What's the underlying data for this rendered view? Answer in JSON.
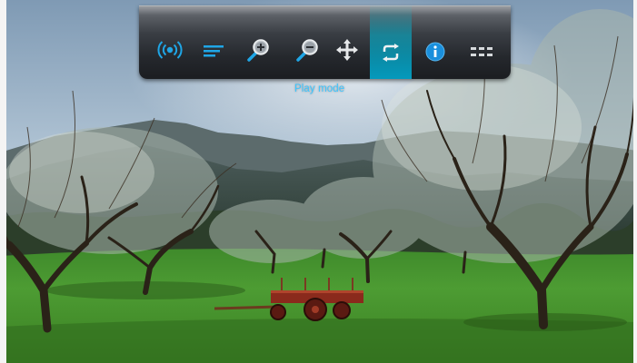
{
  "toolbar": {
    "selected": "play-mode",
    "tooltip": "Play mode",
    "buttons": [
      {
        "id": "broadcast",
        "icon": "broadcast-icon"
      },
      {
        "id": "playlist",
        "icon": "list-icon"
      },
      {
        "id": "zoom-in",
        "icon": "zoom-in-icon"
      },
      {
        "id": "zoom-out",
        "icon": "zoom-out-icon"
      },
      {
        "id": "pan",
        "icon": "move-arrows-icon"
      },
      {
        "id": "play-mode",
        "icon": "repeat-icon"
      },
      {
        "id": "info",
        "icon": "info-icon"
      },
      {
        "id": "menu",
        "icon": "grid-menu-icon"
      }
    ]
  },
  "colors": {
    "accent": "#1fa6e6",
    "tooltip": "#3ec6ff",
    "selected_highlight": "#00b4dc"
  }
}
